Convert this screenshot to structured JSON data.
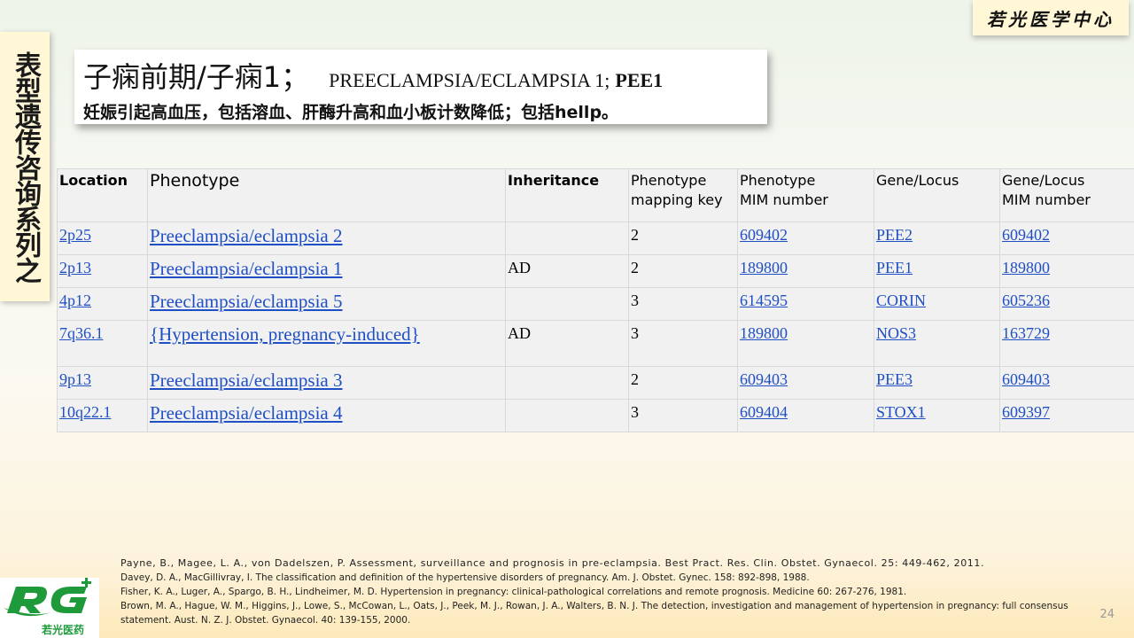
{
  "banner": {
    "side_text": "表型遗传咨询系列之",
    "brand": "若光医学中心"
  },
  "title": {
    "cn": "子痫前期/子痫1；",
    "en": "PREECLAMPSIA/ECLAMPSIA 1;",
    "gene": "PEE1",
    "subtitle": "妊娠引起高血压，包括溶血、肝酶升高和血小板计数降低；包括hellp。"
  },
  "table": {
    "headers": {
      "location": "Location",
      "phenotype": "Phenotype",
      "inheritance": "Inheritance",
      "mapping_key_1": "Phenotype",
      "mapping_key_2": "mapping key",
      "pheno_mim_1": "Phenotype",
      "pheno_mim_2": "MIM number",
      "gene_locus": "Gene/Locus",
      "gene_mim_1": "Gene/Locus",
      "gene_mim_2": "MIM number"
    },
    "rows": [
      {
        "location": "2p25",
        "phenotype": "Preeclampsia/eclampsia 2",
        "inheritance": "",
        "mapping_key": "2",
        "pheno_mim": "609402",
        "gene": "PEE2",
        "gene_mim": "609402"
      },
      {
        "location": "2p13",
        "phenotype": "Preeclampsia/eclampsia 1",
        "inheritance": "AD",
        "mapping_key": "2",
        "pheno_mim": "189800",
        "gene": "PEE1",
        "gene_mim": "189800"
      },
      {
        "location": "4p12",
        "phenotype": "Preeclampsia/eclampsia 5",
        "inheritance": "",
        "mapping_key": "3",
        "pheno_mim": "614595",
        "gene": "CORIN",
        "gene_mim": "605236"
      },
      {
        "location": "7q36.1",
        "phenotype": "{Hypertension, pregnancy-induced}",
        "inheritance": "AD",
        "mapping_key": "3",
        "pheno_mim": "189800",
        "gene": "NOS3",
        "gene_mim": "163729"
      },
      {
        "location": "9p13",
        "phenotype": "Preeclampsia/eclampsia 3",
        "inheritance": "",
        "mapping_key": "2",
        "pheno_mim": "609403",
        "gene": "PEE3",
        "gene_mim": "609403"
      },
      {
        "location": "10q22.1",
        "phenotype": "Preeclampsia/eclampsia 4",
        "inheritance": "",
        "mapping_key": "3",
        "pheno_mim": "609404",
        "gene": "STOX1",
        "gene_mim": "609397"
      }
    ]
  },
  "references": [
    "Payne, B., Magee, L. A., von Dadelszen, P. Assessment, surveillance and prognosis in pre-eclampsia. Best Pract. Res. Clin. Obstet. Gynaecol. 25: 449-462, 2011.",
    "Davey, D. A., MacGillivray, I. The classification and definition of the hypertensive disorders of pregnancy. Am. J. Obstet. Gynec. 158: 892-898, 1988.",
    "Fisher, K. A., Luger, A., Spargo, B. H., Lindheimer, M. D. Hypertension in pregnancy: clinical-pathological correlations and remote prognosis. Medicine 60: 267-276, 1981.",
    "Brown, M. A., Hague, W. M., Higgins, J., Lowe, S., McCowan, L., Oats, J., Peek, M. J., Rowan, J. A., Walters, B. N. J. The detection, investigation and management of hypertension in pregnancy: full consensus statement. Aust. N. Z. J. Obstet. Gynaecol. 40: 139-155, 2000."
  ],
  "page_number": "24",
  "logo": {
    "caption": "若光医药",
    "icon": "rg-logo-icon"
  },
  "colors": {
    "link": "#1f4fc4",
    "logo_green": "#1e9a3b",
    "banner_bg": "#fff7d6"
  }
}
